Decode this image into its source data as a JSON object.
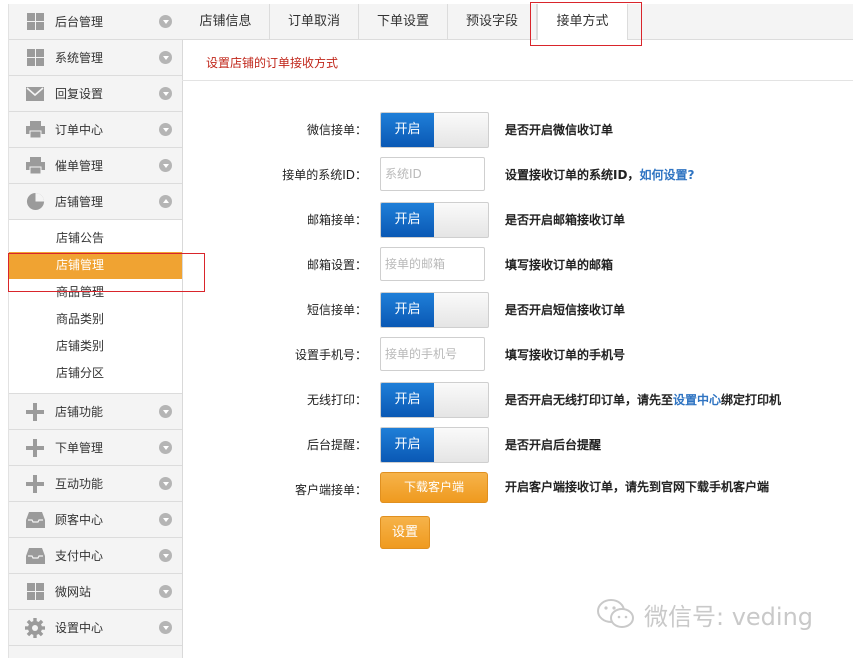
{
  "sidebar": {
    "items": [
      {
        "label": "后台管理",
        "icon": "grid-icon",
        "arrow": "down"
      },
      {
        "label": "系统管理",
        "icon": "grid-icon",
        "arrow": "down"
      },
      {
        "label": "回复设置",
        "icon": "mail-icon",
        "arrow": "down"
      },
      {
        "label": "订单中心",
        "icon": "printer-icon",
        "arrow": "down"
      },
      {
        "label": "催单管理",
        "icon": "printer-icon",
        "arrow": "down"
      },
      {
        "label": "店铺管理",
        "icon": "pie-chart-icon",
        "arrow": "up"
      }
    ],
    "submenu": [
      {
        "label": "店铺公告",
        "active": false
      },
      {
        "label": "店铺管理",
        "active": true
      },
      {
        "label": "商品管理",
        "active": false
      },
      {
        "label": "商品类别",
        "active": false
      },
      {
        "label": "店铺类别",
        "active": false
      },
      {
        "label": "店铺分区",
        "active": false
      }
    ],
    "items_after": [
      {
        "label": "店铺功能",
        "icon": "plus-icon",
        "arrow": "down"
      },
      {
        "label": "下单管理",
        "icon": "plus-icon",
        "arrow": "down"
      },
      {
        "label": "互动功能",
        "icon": "plus-icon",
        "arrow": "down"
      },
      {
        "label": "顾客中心",
        "icon": "inbox-icon",
        "arrow": "down"
      },
      {
        "label": "支付中心",
        "icon": "inbox-icon",
        "arrow": "down"
      },
      {
        "label": "微网站",
        "icon": "grid-icon",
        "arrow": "down"
      },
      {
        "label": "设置中心",
        "icon": "gear-icon",
        "arrow": "down"
      }
    ]
  },
  "tabs": [
    "店铺信息",
    "订单取消",
    "下单设置",
    "预设字段",
    "接单方式"
  ],
  "active_tab": "接单方式",
  "hint": "设置店铺的订单接收方式",
  "form": {
    "wechat": {
      "label": "微信接单：",
      "toggle": "开启",
      "desc": "是否开启微信收订单"
    },
    "system_id": {
      "label": "接单的系统ID：",
      "placeholder": "系统ID",
      "desc": "设置接收订单的系统ID，",
      "link": "如何设置?"
    },
    "email_order": {
      "label": "邮箱接单：",
      "toggle": "开启",
      "desc": "是否开启邮箱接收订单"
    },
    "email_setting": {
      "label": "邮箱设置：",
      "placeholder": "接单的邮箱",
      "desc": "填写接收订单的邮箱"
    },
    "sms_order": {
      "label": "短信接单：",
      "toggle": "开启",
      "desc": "是否开启短信接收订单"
    },
    "phone": {
      "label": "设置手机号：",
      "placeholder": "接单的手机号",
      "desc": "填写接收订单的手机号"
    },
    "wireless_print": {
      "label": "无线打印：",
      "toggle": "开启",
      "desc_before": "是否开启无线打印订单，请先至",
      "link": "设置中心",
      "desc_after": "绑定打印机"
    },
    "backend_alert": {
      "label": "后台提醒：",
      "toggle": "开启",
      "desc": "是否开启后台提醒"
    },
    "client_order": {
      "label": "客户端接单：",
      "button": "下载客户端",
      "desc": "开启客户端接收订单，请先到官网下载手机客户端"
    },
    "submit": "设置"
  },
  "watermark": "微信号: veding",
  "colors": {
    "accent": "#f0a332",
    "toggle_blue": "#0a58b4",
    "link": "#2f74c2",
    "hint_red": "#c0261a",
    "highlight_box": "#d9252b"
  }
}
